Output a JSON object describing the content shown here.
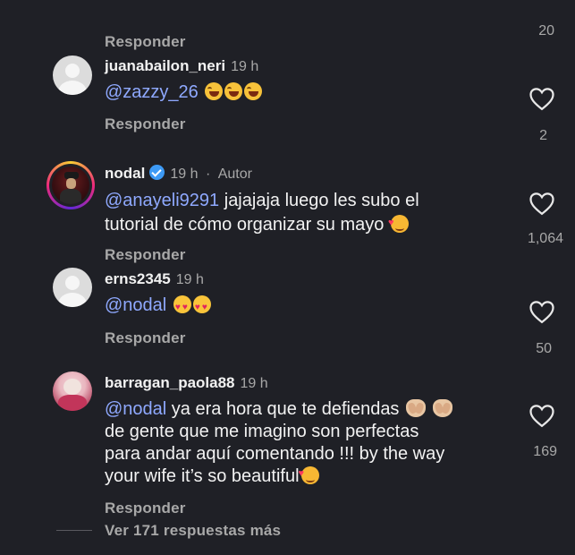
{
  "top_partial_count": "20",
  "comments": [
    {
      "username": "",
      "time": "",
      "reply": "Responder"
    },
    {
      "username": "juanabailon_neri",
      "time": "19 h",
      "mention": "@zazzy_26",
      "text_lines": [
        ""
      ],
      "likes": "2",
      "reply": "Responder",
      "emoji": [
        "laugh-emoji",
        "laugh-emoji",
        "laugh-emoji"
      ]
    },
    {
      "username": "nodal",
      "time": "19 h",
      "separator": "·",
      "author_tag": "Autor",
      "mention": "@anayeli9291",
      "text_lines": [
        " jajajaja luego les subo el",
        "tutorial de cómo organizar su mayo"
      ],
      "likes": "1,064",
      "reply": "Responder",
      "emoji": [
        "smiling-face-with-hearts-emoji"
      ]
    },
    {
      "username": "erns2345",
      "time": "19 h",
      "mention": "@nodal",
      "text_lines": [
        ""
      ],
      "likes": "50",
      "reply": "Responder",
      "emoji": [
        "heart-eyes-emoji",
        "heart-eyes-emoji"
      ]
    },
    {
      "username": "barragan_paola88",
      "time": "19 h",
      "mention": "@nodal",
      "text_lines": [
        " ya era hora que te defiendas",
        "de gente que me imagino son perfectas",
        "para andar aquí comentando !!! by the way",
        "your wife it’s so beautiful"
      ],
      "likes": "169",
      "reply": "Responder",
      "emoji": [
        "clapping-hands-emoji",
        "clapping-hands-emoji",
        "smiling-face-with-hearts-emoji"
      ]
    }
  ],
  "view_more": "Ver 171 respuestas más",
  "colors": {
    "background": "#1f2026",
    "mention": "#8fa9ff",
    "secondary": "#a8a8a8",
    "verified": "#3d9af5"
  }
}
